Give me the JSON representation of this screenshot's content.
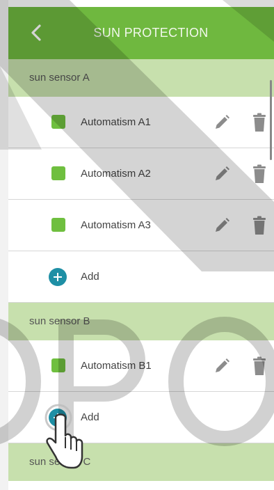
{
  "header": {
    "title": "SUN PROTECTION"
  },
  "sections": [
    {
      "name": "sun sensor A",
      "items": [
        {
          "label": "Automatism A1"
        },
        {
          "label": "Automatism A2"
        },
        {
          "label": "Automatism A3"
        }
      ],
      "add_label": "Add"
    },
    {
      "name": "sun sensor B",
      "items": [
        {
          "label": "Automatism B1"
        }
      ],
      "add_label": "Add"
    },
    {
      "name": "sun sensor C",
      "items": []
    }
  ],
  "colors": {
    "header": "#6fb83f",
    "section": "#c7e0ad",
    "status_square": "#6fbf3f",
    "add_button": "#1e8fa5"
  },
  "icons": {
    "back": "chevron-left-icon",
    "edit": "pencil-icon",
    "delete": "trash-icon",
    "add": "plus-icon",
    "cursor": "hand-pointer-icon"
  }
}
